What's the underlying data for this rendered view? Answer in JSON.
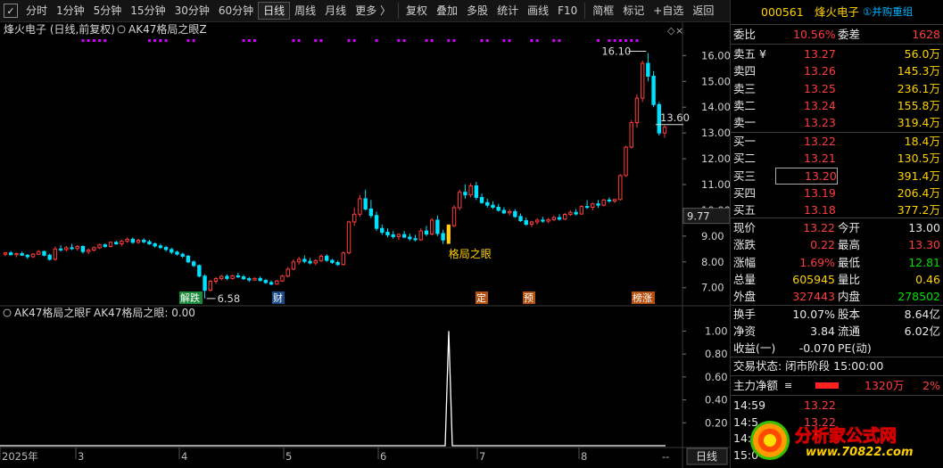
{
  "toolbar": {
    "checkbox": "✓",
    "items": [
      "分时",
      "1分钟",
      "5分钟",
      "15分钟",
      "30分钟",
      "60分钟",
      "日线",
      "周线",
      "月线",
      "更多 〉",
      "复权",
      "叠加",
      "多股",
      "统计",
      "画线",
      "F10",
      "简框",
      "标记",
      "+自选",
      "返回"
    ],
    "active": "日线"
  },
  "main_chart": {
    "title_stock": "烽火电子 (日线,前复权)",
    "indicator_title": "AK47格局之眼Z",
    "price_axis": [
      "16.00",
      "15.00",
      "14.00",
      "13.00",
      "12.00",
      "11.00",
      "10.00",
      "9.00",
      "8.00",
      "7.00"
    ],
    "current_price_label": "13.60",
    "crosshair_price_label": "9.77",
    "high_label": "16.10",
    "low_label": "6.58",
    "signal_label": "格局之眼",
    "event_badges": [
      {
        "text": "解跌",
        "color": "#1a8a3a"
      },
      {
        "text": "财",
        "color": "#1a4a8a"
      },
      {
        "text": "定",
        "color": "#b45010"
      },
      {
        "text": "预",
        "color": "#b45010"
      },
      {
        "text": "榜涨",
        "color": "#b45010"
      }
    ]
  },
  "sub_chart": {
    "title": "AK47格局之眼F",
    "value_label": "AK47格局之眼: 0.00",
    "axis": [
      "1.00",
      "0.80",
      "0.60",
      "0.40",
      "0.20"
    ],
    "spike_value": 1.0
  },
  "x_axis": {
    "labels": [
      "2025年",
      "3",
      "4",
      "5",
      "6",
      "7",
      "8"
    ],
    "period_button": "日线"
  },
  "chart_data": {
    "type": "candlestick",
    "ylim": [
      6.3,
      16.6
    ],
    "ohlc": [
      [
        8.3,
        8.38,
        8.22,
        8.35
      ],
      [
        8.35,
        8.42,
        8.25,
        8.28
      ],
      [
        8.28,
        8.36,
        8.18,
        8.32
      ],
      [
        8.32,
        8.4,
        8.24,
        8.26
      ],
      [
        8.26,
        8.3,
        8.12,
        8.2
      ],
      [
        8.2,
        8.34,
        8.16,
        8.3
      ],
      [
        8.3,
        8.46,
        8.26,
        8.4
      ],
      [
        8.4,
        8.44,
        8.22,
        8.26
      ],
      [
        8.26,
        8.32,
        8.05,
        8.1
      ],
      [
        8.1,
        8.6,
        8.05,
        8.5
      ],
      [
        8.5,
        8.65,
        8.4,
        8.48
      ],
      [
        8.48,
        8.62,
        8.4,
        8.55
      ],
      [
        8.55,
        8.7,
        8.46,
        8.52
      ],
      [
        8.52,
        8.65,
        8.44,
        8.6
      ],
      [
        8.6,
        8.64,
        8.32,
        8.4
      ],
      [
        8.4,
        8.52,
        8.3,
        8.46
      ],
      [
        8.46,
        8.6,
        8.4,
        8.55
      ],
      [
        8.55,
        8.7,
        8.5,
        8.66
      ],
      [
        8.66,
        8.72,
        8.55,
        8.6
      ],
      [
        8.6,
        8.8,
        8.56,
        8.76
      ],
      [
        8.76,
        8.82,
        8.66,
        8.7
      ],
      [
        8.7,
        8.85,
        8.62,
        8.8
      ],
      [
        8.8,
        8.95,
        8.74,
        8.88
      ],
      [
        8.88,
        8.95,
        8.7,
        8.76
      ],
      [
        8.76,
        8.9,
        8.7,
        8.84
      ],
      [
        8.84,
        8.92,
        8.72,
        8.78
      ],
      [
        8.78,
        8.86,
        8.66,
        8.7
      ],
      [
        8.7,
        8.76,
        8.55,
        8.62
      ],
      [
        8.62,
        8.7,
        8.5,
        8.56
      ],
      [
        8.56,
        8.62,
        8.4,
        8.48
      ],
      [
        8.48,
        8.55,
        8.3,
        8.38
      ],
      [
        8.38,
        8.44,
        8.25,
        8.3
      ],
      [
        8.3,
        8.36,
        8.15,
        8.22
      ],
      [
        8.22,
        8.28,
        7.95,
        8.0
      ],
      [
        8.0,
        8.06,
        7.8,
        7.86
      ],
      [
        7.86,
        7.9,
        7.4,
        7.45
      ],
      [
        7.45,
        7.52,
        6.58,
        6.9
      ],
      [
        6.9,
        7.3,
        6.86,
        7.25
      ],
      [
        7.25,
        7.42,
        7.15,
        7.35
      ],
      [
        7.35,
        7.5,
        7.28,
        7.44
      ],
      [
        7.44,
        7.52,
        7.3,
        7.36
      ],
      [
        7.36,
        7.5,
        7.32,
        7.46
      ],
      [
        7.46,
        7.58,
        7.38,
        7.42
      ],
      [
        7.42,
        7.5,
        7.3,
        7.35
      ],
      [
        7.35,
        7.42,
        7.22,
        7.3
      ],
      [
        7.3,
        7.4,
        7.26,
        7.36
      ],
      [
        7.36,
        7.44,
        7.24,
        7.28
      ],
      [
        7.28,
        7.34,
        7.15,
        7.2
      ],
      [
        7.2,
        7.28,
        7.1,
        7.14
      ],
      [
        7.14,
        7.3,
        7.12,
        7.26
      ],
      [
        7.26,
        7.5,
        7.22,
        7.45
      ],
      [
        7.45,
        7.8,
        7.4,
        7.72
      ],
      [
        7.72,
        8.1,
        7.68,
        8.0
      ],
      [
        8.0,
        8.2,
        7.9,
        8.1
      ],
      [
        8.1,
        8.25,
        7.95,
        8.02
      ],
      [
        8.02,
        8.15,
        7.9,
        7.96
      ],
      [
        7.96,
        8.1,
        7.88,
        8.05
      ],
      [
        8.05,
        8.3,
        8.0,
        8.22
      ],
      [
        8.22,
        8.3,
        8.0,
        8.06
      ],
      [
        8.06,
        8.12,
        7.92,
        7.98
      ],
      [
        7.98,
        8.05,
        7.85,
        7.9
      ],
      [
        7.9,
        8.4,
        7.86,
        8.35
      ],
      [
        8.35,
        9.6,
        8.3,
        9.55
      ],
      [
        9.55,
        10.1,
        9.4,
        9.85
      ],
      [
        9.85,
        10.6,
        9.75,
        10.45
      ],
      [
        10.45,
        10.8,
        10.0,
        10.05
      ],
      [
        10.05,
        10.4,
        9.7,
        9.8
      ],
      [
        9.8,
        9.95,
        9.2,
        9.3
      ],
      [
        9.3,
        9.45,
        9.05,
        9.15
      ],
      [
        9.15,
        9.3,
        8.95,
        9.05
      ],
      [
        9.05,
        9.2,
        8.9,
        8.98
      ],
      [
        8.98,
        9.12,
        8.85,
        9.06
      ],
      [
        9.06,
        9.2,
        8.92,
        8.96
      ],
      [
        8.96,
        9.1,
        8.82,
        8.9
      ],
      [
        8.9,
        9.05,
        8.8,
        8.86
      ],
      [
        8.86,
        9.3,
        8.82,
        9.2
      ],
      [
        9.2,
        9.4,
        9.0,
        9.08
      ],
      [
        9.08,
        9.7,
        9.04,
        9.62
      ],
      [
        9.62,
        9.8,
        9.0,
        9.1
      ],
      [
        9.1,
        9.25,
        8.7,
        8.85
      ],
      [
        8.85,
        9.45,
        8.8,
        9.4
      ],
      [
        9.4,
        10.2,
        9.35,
        10.1
      ],
      [
        10.1,
        10.8,
        10.0,
        10.7
      ],
      [
        10.7,
        11.0,
        10.45,
        10.6
      ],
      [
        10.6,
        11.05,
        10.5,
        10.95
      ],
      [
        10.95,
        11.1,
        10.4,
        10.5
      ],
      [
        10.5,
        10.65,
        10.25,
        10.3
      ],
      [
        10.3,
        10.45,
        10.1,
        10.2
      ],
      [
        10.2,
        10.35,
        10.05,
        10.12
      ],
      [
        10.12,
        10.25,
        9.95,
        10.0
      ],
      [
        10.0,
        10.12,
        9.85,
        9.9
      ],
      [
        9.9,
        10.05,
        9.8,
        9.95
      ],
      [
        9.95,
        10.05,
        9.7,
        9.76
      ],
      [
        9.76,
        9.88,
        9.55,
        9.6
      ],
      [
        9.6,
        9.72,
        9.4,
        9.46
      ],
      [
        9.46,
        9.6,
        9.35,
        9.55
      ],
      [
        9.55,
        9.7,
        9.45,
        9.62
      ],
      [
        9.62,
        9.75,
        9.52,
        9.58
      ],
      [
        9.58,
        9.7,
        9.5,
        9.64
      ],
      [
        9.64,
        9.8,
        9.58,
        9.72
      ],
      [
        9.72,
        9.85,
        9.6,
        9.66
      ],
      [
        9.66,
        9.9,
        9.62,
        9.84
      ],
      [
        9.84,
        10.0,
        9.78,
        9.92
      ],
      [
        9.92,
        10.05,
        9.8,
        9.86
      ],
      [
        9.86,
        10.2,
        9.82,
        10.15
      ],
      [
        10.15,
        10.4,
        10.05,
        10.12
      ],
      [
        10.12,
        10.3,
        10.0,
        10.25
      ],
      [
        10.25,
        10.4,
        10.1,
        10.2
      ],
      [
        10.2,
        10.45,
        10.15,
        10.4
      ],
      [
        10.4,
        10.5,
        10.3,
        10.36
      ],
      [
        10.36,
        10.45,
        10.28,
        10.42
      ],
      [
        10.42,
        11.4,
        10.38,
        11.35
      ],
      [
        11.35,
        12.5,
        11.3,
        12.45
      ],
      [
        12.45,
        13.5,
        12.4,
        13.4
      ],
      [
        13.4,
        14.5,
        13.2,
        14.35
      ],
      [
        14.35,
        15.8,
        14.2,
        15.7
      ],
      [
        15.7,
        16.1,
        15.0,
        15.2
      ],
      [
        15.2,
        15.4,
        14.0,
        14.1
      ],
      [
        14.1,
        14.2,
        12.9,
        13.0
      ],
      [
        13.0,
        13.3,
        12.81,
        13.22
      ]
    ],
    "signal_x": [
      14,
      15,
      16,
      17,
      18,
      26,
      27,
      28,
      29,
      33,
      34,
      43,
      44,
      45,
      52,
      53,
      56,
      57,
      62,
      63,
      67,
      71,
      72,
      76,
      77,
      80,
      81,
      86,
      87,
      90,
      91,
      95,
      96,
      99,
      100,
      107,
      109,
      110,
      111,
      112,
      113,
      114
    ]
  },
  "right_panel": {
    "code": "000561",
    "name": "烽火电子",
    "reorg": "①并购重组",
    "weibi_label": "委比",
    "weibi": "10.56%",
    "weicha_label": "委差",
    "weicha": "1628",
    "asks": [
      {
        "label": "卖五",
        "yen": "¥",
        "price": "13.27",
        "vol": "56.0万"
      },
      {
        "label": "卖四",
        "price": "13.26",
        "vol": "145.3万"
      },
      {
        "label": "卖三",
        "price": "13.25",
        "vol": "236.1万"
      },
      {
        "label": "卖二",
        "price": "13.24",
        "vol": "155.8万"
      },
      {
        "label": "卖一",
        "price": "13.23",
        "vol": "319.4万"
      }
    ],
    "bids": [
      {
        "label": "买一",
        "price": "13.22",
        "vol": "18.4万"
      },
      {
        "label": "买二",
        "price": "13.21",
        "vol": "130.5万"
      },
      {
        "label": "买三",
        "price": "13.20",
        "vol": "391.4万"
      },
      {
        "label": "买四",
        "price": "13.19",
        "vol": "206.4万"
      },
      {
        "label": "买五",
        "price": "13.18",
        "vol": "377.2万"
      }
    ],
    "stats": [
      {
        "l1": "现价",
        "v1": "13.22",
        "c1": "red",
        "l2": "今开",
        "v2": "13.00",
        "c2": "white"
      },
      {
        "l1": "涨跌",
        "v1": "0.22",
        "c1": "red",
        "l2": "最高",
        "v2": "13.30",
        "c2": "red"
      },
      {
        "l1": "涨幅",
        "v1": "1.69%",
        "c1": "red",
        "l2": "最低",
        "v2": "12.81",
        "c2": "green"
      },
      {
        "l1": "总量",
        "v1": "605945",
        "c1": "yellow",
        "l2": "量比",
        "v2": "0.46",
        "c2": "yellow"
      },
      {
        "l1": "外盘",
        "v1": "327443",
        "c1": "red",
        "l2": "内盘",
        "v2": "278502",
        "c2": "green"
      }
    ],
    "stats2": [
      {
        "l1": "换手",
        "v1": "10.07%",
        "l2": "股本",
        "v2": "8.64亿"
      },
      {
        "l1": "净资",
        "v1": "3.84",
        "l2": "流通",
        "v2": "6.02亿"
      }
    ],
    "income_label": "收益(一)",
    "income": "-0.070",
    "pe_label": "PE(动)",
    "trade_status": "交易状态: 闭市阶段 15:00:00",
    "main_flow_label": "主力净额",
    "main_flow_value": "1320万",
    "main_flow_pct": "2%",
    "ticks": [
      {
        "time": "14:59",
        "price": "13.22"
      },
      {
        "time": "14:5",
        "price": "13.22"
      },
      {
        "time": "14:5",
        "price": ""
      },
      {
        "time": "15:0",
        "price": ""
      }
    ]
  },
  "watermark": {
    "text": "分析家公式网",
    "url": "www.70822.com"
  },
  "colors": {
    "up": "#ff3c3c",
    "down": "#00e0ff",
    "signal": "#d400ff",
    "yellow": "#ffd200",
    "grid": "#2a2a2a"
  }
}
